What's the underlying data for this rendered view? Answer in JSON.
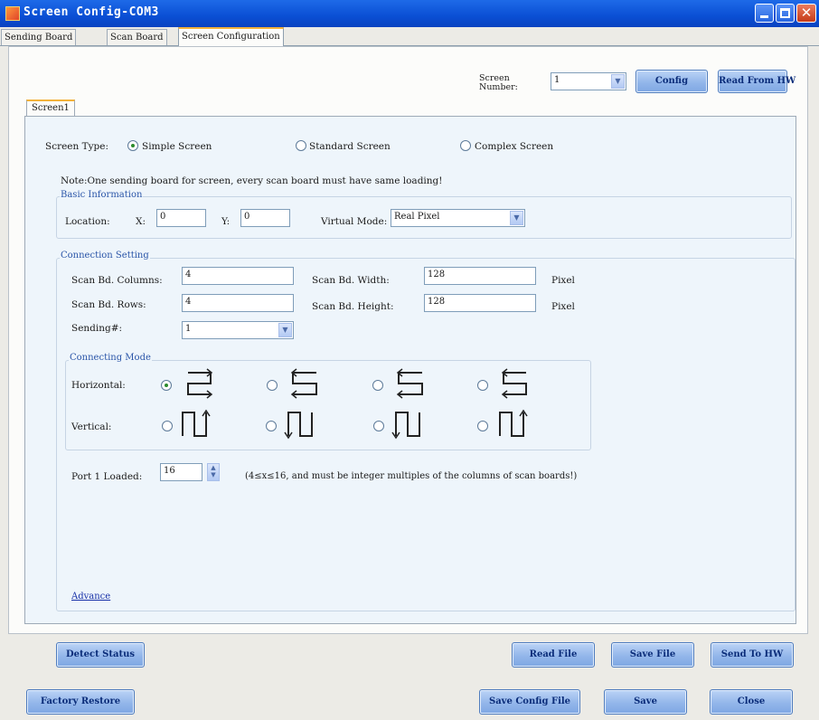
{
  "window": {
    "title": "Screen Config-COM3"
  },
  "tabs": [
    "Sending Board",
    "Scan Board",
    "Screen Configuration"
  ],
  "header": {
    "screen_number_label_1": "Screen",
    "screen_number_label_2": "Number:",
    "screen_number_value": "1",
    "config_button": "Config",
    "read_from_hw_button": "Read From HW"
  },
  "screen_tab": "Screen1",
  "screen_type": {
    "label": "Screen Type:",
    "options": [
      "Simple Screen",
      "Standard Screen",
      "Complex Screen"
    ],
    "selected": "Simple Screen"
  },
  "note": "Note:One sending board for screen, every scan board must have same loading!",
  "basic_info": {
    "legend": "Basic Information",
    "location_label": "Location:",
    "x_label": "X:",
    "x_value": "0",
    "y_label": "Y:",
    "y_value": "0",
    "virtual_mode_label": "Virtual Mode:",
    "virtual_mode_value": "Real Pixel"
  },
  "connection": {
    "legend": "Connection Setting",
    "columns_label": "Scan Bd. Columns:",
    "columns_value": "4",
    "rows_label": "Scan Bd. Rows:",
    "rows_value": "4",
    "sending_label": "Sending#:",
    "sending_value": "1",
    "width_label": "Scan Bd. Width:",
    "width_value": "128",
    "width_unit": "Pixel",
    "height_label": "Scan Bd. Height:",
    "height_value": "128",
    "height_unit": "Pixel"
  },
  "connecting_mode": {
    "legend": "Connecting Mode",
    "horizontal_label": "Horizontal:",
    "vertical_label": "Vertical:",
    "selected": "horizontal-1"
  },
  "port": {
    "label": "Port 1 Loaded:",
    "value": "16",
    "hint": "(4≤x≤16, and must be integer multiples of the columns of scan boards!)"
  },
  "advance_link": "Advance",
  "buttons": {
    "detect_status": "Detect Status",
    "read_file": "Read File",
    "save_file": "Save File",
    "send_to_hw": "Send To HW",
    "factory_restore": "Factory Restore",
    "save_config_file": "Save Config File",
    "save": "Save",
    "close": "Close"
  }
}
